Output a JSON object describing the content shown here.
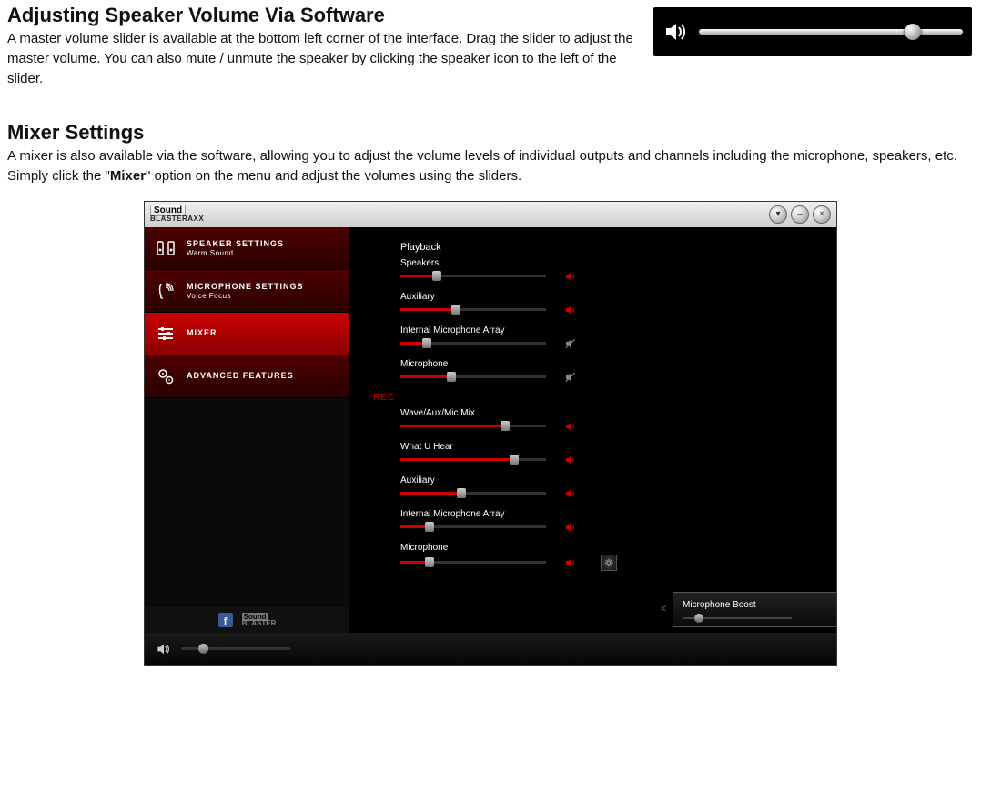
{
  "doc": {
    "sec1_title": "Adjusting Speaker Volume Via Software",
    "sec1_body": "A master volume slider is available at the bottom left corner of the interface. Drag the slider to adjust the master volume. You can also mute / unmute the speaker by clicking the speaker icon to the left of the slider.",
    "sec2_title": "Mixer Settings",
    "sec2_body_a": "A mixer is also available via the software, allowing you to adjust the volume levels of individual outputs and channels including the microphone, speakers, etc. Simply click the \"",
    "sec2_body_bold": "Mixer",
    "sec2_body_b": "\" option on the menu and adjust the volumes using the sliders."
  },
  "master_volume": {
    "percent": 78
  },
  "app": {
    "brand_top": "Sound",
    "brand_bottom": "BLASTERAXX",
    "nav": [
      {
        "label": "SPEAKER SETTINGS",
        "sub": "Warm Sound",
        "icon": "speaker-pair-icon",
        "active": false
      },
      {
        "label": "MICROPHONE SETTINGS",
        "sub": "Voice Focus",
        "icon": "voice-icon",
        "active": false
      },
      {
        "label": "MIXER",
        "sub": "",
        "icon": "sliders-icon",
        "active": true
      },
      {
        "label": "ADVANCED FEATURES",
        "sub": "",
        "icon": "gears-icon",
        "active": false
      }
    ],
    "sidebar_footer_brand_top": "Sound",
    "sidebar_footer_brand_bottom": "BLASTER",
    "playback_label": "Playback",
    "rec_label": "REC",
    "playback": [
      {
        "name": "Speakers",
        "value": 25,
        "muted": false
      },
      {
        "name": "Auxiliary",
        "value": 38,
        "muted": false
      },
      {
        "name": "Internal Microphone Array",
        "value": 18,
        "muted": true
      },
      {
        "name": "Microphone",
        "value": 35,
        "muted": true
      }
    ],
    "rec": [
      {
        "name": "Wave/Aux/Mic Mix",
        "value": 72,
        "muted": false
      },
      {
        "name": "What U Hear",
        "value": 78,
        "muted": false
      },
      {
        "name": "Auxiliary",
        "value": 42,
        "muted": false
      },
      {
        "name": "Internal Microphone Array",
        "value": 20,
        "muted": false
      },
      {
        "name": "Microphone",
        "value": 20,
        "muted": false,
        "has_gear": true
      }
    ],
    "popup_label": "Microphone Boost",
    "popup_value": 15,
    "footer_volume": 20
  }
}
